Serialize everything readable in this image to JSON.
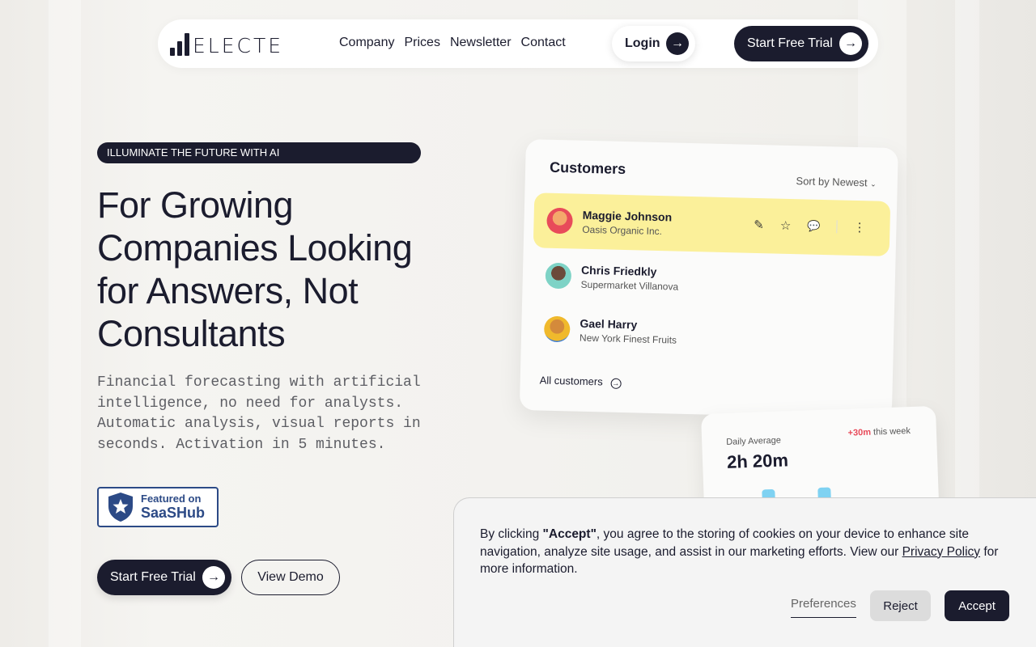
{
  "nav": {
    "logo_text": "ELECTE",
    "menu": [
      "Company",
      "Prices",
      "Newsletter",
      "Contact"
    ],
    "login_label": "Login",
    "trial_label": "Start Free Trial"
  },
  "hero": {
    "tagline": "ILLUMINATE THE FUTURE WITH AI",
    "title_lines": [
      "For Growing",
      "Companies Looking",
      "for Answers, Not",
      "Consultants"
    ],
    "description": "Financial forecasting with artificial intelligence, no need for analysts. Automatic analysis, visual reports in seconds. Activation in 5 minutes.",
    "badge_line1": "Featured on",
    "badge_line2": "SaaSHub",
    "trial_label": "Start Free Trial",
    "demo_label": "View Demo"
  },
  "customers": {
    "title": "Customers",
    "sort_label": "Sort by Newest",
    "rows": [
      {
        "name": "Maggie Johnson",
        "company": "Oasis Organic Inc."
      },
      {
        "name": "Chris Friedkly",
        "company": "Supermarket Villanova"
      },
      {
        "name": "Gael Harry",
        "company": "New York Finest Fruits"
      }
    ],
    "all_label": "All customers"
  },
  "daily": {
    "label": "Daily Average",
    "value": "2h 20m",
    "delta": "+30m",
    "delta_suffix": "this week"
  },
  "cookie": {
    "pre": "By clicking ",
    "accept_quote": "\"Accept\"",
    "middle": ", you agree to the storing of cookies on your device to enhance site navigation, analyze site usage, and assist in our marketing efforts. View our ",
    "policy_link": "Privacy Policy",
    "post": " for more information.",
    "preferences_label": "Preferences",
    "reject_label": "Reject",
    "accept_label": "Accept"
  },
  "colors": {
    "brand_dark": "#1b1c2e",
    "highlight_row": "#fbf09a",
    "delta_positive": "#e84b5a",
    "saashub_blue": "#2c4a86"
  }
}
